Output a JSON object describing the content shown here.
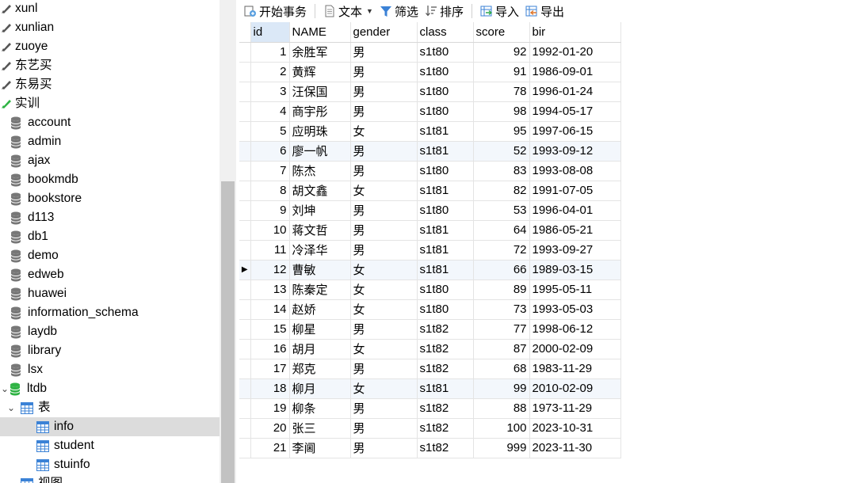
{
  "sidebar": {
    "items": [
      {
        "label": "xunl",
        "kind": "connection",
        "color": "#555555"
      },
      {
        "label": "xunlian",
        "kind": "connection",
        "color": "#555555"
      },
      {
        "label": "zuoye",
        "kind": "connection",
        "color": "#555555"
      },
      {
        "label": "东艺买",
        "kind": "connection",
        "color": "#555555"
      },
      {
        "label": "东易买",
        "kind": "connection",
        "color": "#555555"
      },
      {
        "label": "实训",
        "kind": "connection-open",
        "color": "#2fb344"
      },
      {
        "label": "account",
        "kind": "database"
      },
      {
        "label": "admin",
        "kind": "database"
      },
      {
        "label": "ajax",
        "kind": "database"
      },
      {
        "label": "bookmdb",
        "kind": "database"
      },
      {
        "label": "bookstore",
        "kind": "database"
      },
      {
        "label": "d113",
        "kind": "database"
      },
      {
        "label": "db1",
        "kind": "database"
      },
      {
        "label": "demo",
        "kind": "database"
      },
      {
        "label": "edweb",
        "kind": "database"
      },
      {
        "label": "huawei",
        "kind": "database"
      },
      {
        "label": "information_schema",
        "kind": "database"
      },
      {
        "label": "laydb",
        "kind": "database"
      },
      {
        "label": "library",
        "kind": "database"
      },
      {
        "label": "lsx",
        "kind": "database"
      },
      {
        "label": "ltdb",
        "kind": "database-open"
      },
      {
        "label": "表",
        "kind": "tables-folder"
      },
      {
        "label": "info",
        "kind": "table",
        "selected": true
      },
      {
        "label": "student",
        "kind": "table"
      },
      {
        "label": "stuinfo",
        "kind": "table"
      },
      {
        "label": "视图",
        "kind": "views-folder"
      }
    ]
  },
  "toolbar": {
    "begin_transaction": "开始事务",
    "text": "文本",
    "filter": "筛选",
    "sort": "排序",
    "import": "导入",
    "export": "导出"
  },
  "grid": {
    "columns": [
      "id",
      "NAME",
      "gender",
      "class",
      "score",
      "bir"
    ],
    "current_row": 12,
    "rows": [
      [
        "1",
        "余胜军",
        "男",
        "s1t80",
        "92",
        "1992-01-20"
      ],
      [
        "2",
        "黄辉",
        "男",
        "s1t80",
        "91",
        "1986-09-01"
      ],
      [
        "3",
        "汪保国",
        "男",
        "s1t80",
        "78",
        "1996-01-24"
      ],
      [
        "4",
        "商宇彤",
        "男",
        "s1t80",
        "98",
        "1994-05-17"
      ],
      [
        "5",
        "应明珠",
        "女",
        "s1t81",
        "95",
        "1997-06-15"
      ],
      [
        "6",
        "廖一帆",
        "男",
        "s1t81",
        "52",
        "1993-09-12"
      ],
      [
        "7",
        "陈杰",
        "男",
        "s1t80",
        "83",
        "1993-08-08"
      ],
      [
        "8",
        "胡文鑫",
        "女",
        "s1t81",
        "82",
        "1991-07-05"
      ],
      [
        "9",
        "刘坤",
        "男",
        "s1t80",
        "53",
        "1996-04-01"
      ],
      [
        "10",
        "蒋文哲",
        "男",
        "s1t81",
        "64",
        "1986-05-21"
      ],
      [
        "11",
        "冷泽华",
        "男",
        "s1t81",
        "72",
        "1993-09-27"
      ],
      [
        "12",
        "曹敏",
        "女",
        "s1t81",
        "66",
        "1989-03-15"
      ],
      [
        "13",
        "陈秦定",
        "女",
        "s1t80",
        "89",
        "1995-05-11"
      ],
      [
        "14",
        "赵娇",
        "女",
        "s1t80",
        "73",
        "1993-05-03"
      ],
      [
        "15",
        "柳星",
        "男",
        "s1t82",
        "77",
        "1998-06-12"
      ],
      [
        "16",
        "胡月",
        "女",
        "s1t82",
        "87",
        "2000-02-09"
      ],
      [
        "17",
        "郑克",
        "男",
        "s1t82",
        "68",
        "1983-11-29"
      ],
      [
        "18",
        "柳月",
        "女",
        "s1t81",
        "99",
        "2010-02-09"
      ],
      [
        "19",
        "柳条",
        "男",
        "s1t82",
        "88",
        "1973-11-29"
      ],
      [
        "20",
        "张三",
        "男",
        "s1t82",
        "100",
        "2023-10-31"
      ],
      [
        "21",
        "李阃",
        "男",
        "s1t82",
        "999",
        "2023-11-30"
      ]
    ]
  }
}
